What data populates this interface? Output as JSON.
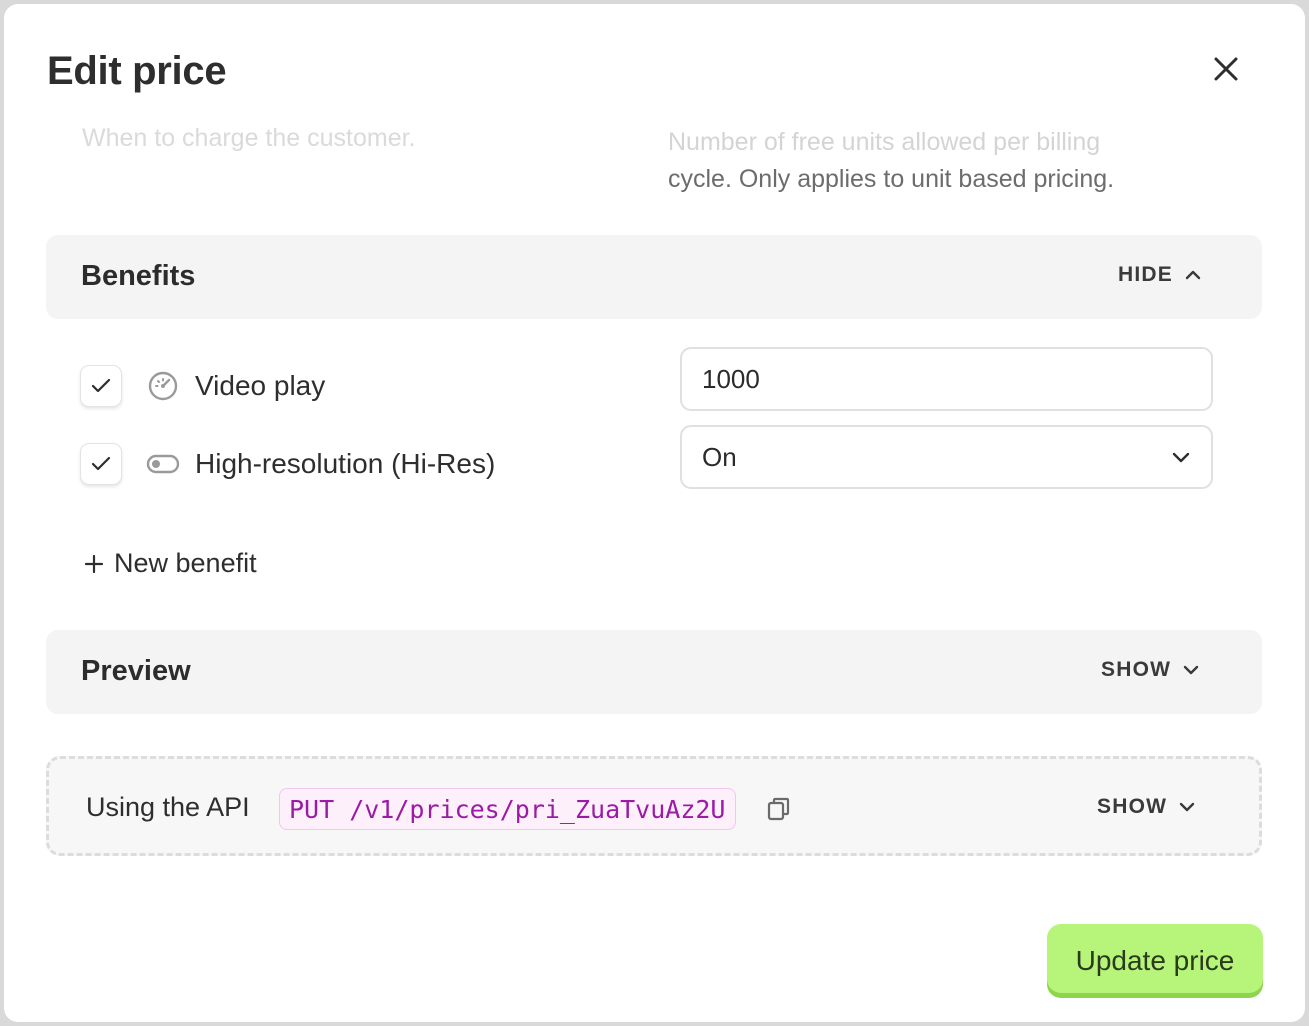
{
  "modal": {
    "title": "Edit price"
  },
  "hints": {
    "left_faded": "When to charge the customer.",
    "right_line1": "Number of free units allowed per billing",
    "right_line2": "cycle. Only applies to unit based pricing."
  },
  "benefits": {
    "title": "Benefits",
    "toggle_label": "HIDE",
    "items": [
      {
        "label": "Video play",
        "icon": "gauge-icon",
        "checked": true,
        "value": "1000"
      },
      {
        "label": "High-resolution (Hi-Res)",
        "icon": "toggle-icon",
        "checked": true,
        "value": "On"
      }
    ],
    "new_benefit_label": "New benefit"
  },
  "preview": {
    "title": "Preview",
    "toggle_label": "SHOW"
  },
  "api": {
    "label": "Using the API",
    "code": "PUT /v1/prices/pri_ZuaTvuAz2U",
    "toggle_label": "SHOW"
  },
  "footer": {
    "submit_label": "Update price",
    "submit_color": "#b6f57a"
  }
}
